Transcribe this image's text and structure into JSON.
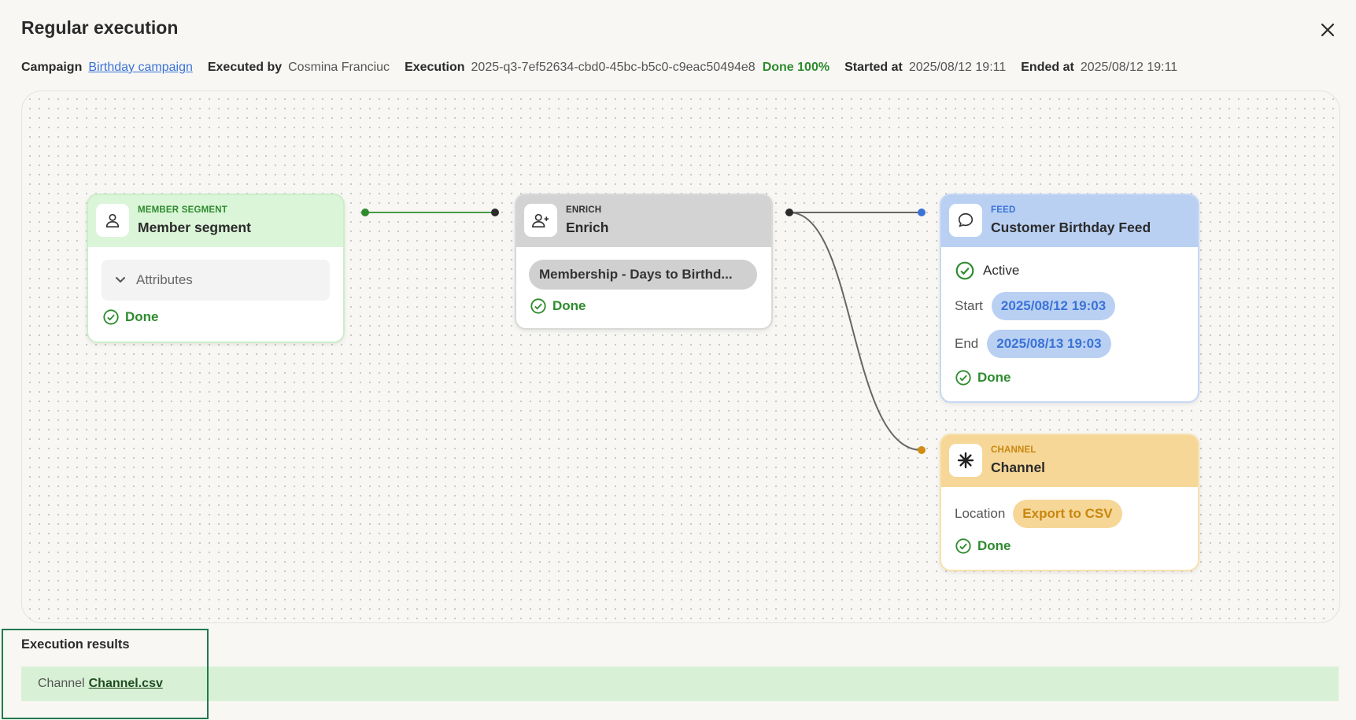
{
  "header": {
    "title": "Regular execution",
    "close_icon": "close-icon"
  },
  "meta": {
    "campaign_label": "Campaign",
    "campaign_value": "Birthday campaign",
    "executed_by_label": "Executed by",
    "executed_by_value": "Cosmina Franciuc",
    "execution_label": "Execution",
    "execution_value": "2025-q3-7ef52634-cbd0-45bc-b5c0-c9eac50494e8",
    "execution_status": "Done 100%",
    "started_label": "Started at",
    "started_value": "2025/08/12 19:11",
    "ended_label": "Ended at",
    "ended_value": "2025/08/12 19:11"
  },
  "flow": {
    "member_segment": {
      "type": "MEMBER SEGMENT",
      "name": "Member segment",
      "icon": "user-icon",
      "attributes_label": "Attributes",
      "status": "Done"
    },
    "enrich": {
      "type": "ENRICH",
      "name": "Enrich",
      "icon": "user-plus-icon",
      "chip": "Membership - Days to Birthd...",
      "status": "Done"
    },
    "feed": {
      "type": "FEED",
      "name": "Customer Birthday Feed",
      "icon": "message-bubble-icon",
      "active": "Active",
      "start_label": "Start",
      "start_value": "2025/08/12 19:03",
      "end_label": "End",
      "end_value": "2025/08/13 19:03",
      "status": "Done"
    },
    "channel": {
      "type": "CHANNEL",
      "name": "Channel",
      "icon": "asterisk-icon",
      "location_label": "Location",
      "location_value": "Export to CSV",
      "status": "Done"
    }
  },
  "results": {
    "title": "Execution results",
    "label": "Channel",
    "file": "Channel.csv"
  },
  "colors": {
    "segment": "#dbf5d9",
    "enrich": "#d3d3d3",
    "feed": "#b9d0f3",
    "channel": "#f6d798",
    "done_green": "#2e8b2e",
    "link_blue": "#3b73d6"
  }
}
